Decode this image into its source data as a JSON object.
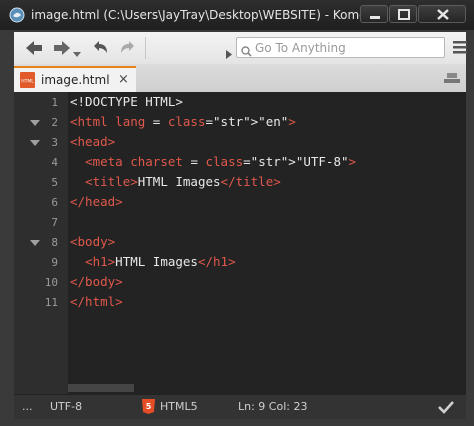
{
  "window": {
    "title": "image.html (C:\\Users\\JayTray\\Desktop\\WEBSITE) - Komodo E..."
  },
  "toolbar": {
    "search_placeholder": "Go To Anything"
  },
  "tabs": [
    {
      "label": "image.html",
      "icon": "html-file-icon",
      "close": "×"
    }
  ],
  "editor": {
    "lines": [
      {
        "num": "1",
        "fold": false,
        "text": "<!DOCTYPE HTML>"
      },
      {
        "num": "2",
        "fold": true,
        "text": "<html lang = \"en\">"
      },
      {
        "num": "3",
        "fold": true,
        "text": "<head>"
      },
      {
        "num": "4",
        "fold": false,
        "text": "  <meta charset = \"UTF-8\">"
      },
      {
        "num": "5",
        "fold": false,
        "text": "  <title>HTML Images</title>"
      },
      {
        "num": "6",
        "fold": false,
        "text": "</head>"
      },
      {
        "num": "7",
        "fold": false,
        "text": ""
      },
      {
        "num": "8",
        "fold": true,
        "text": "<body>"
      },
      {
        "num": "9",
        "fold": false,
        "text": "  <h1>HTML Images</h1>"
      },
      {
        "num": "10",
        "fold": false,
        "text": "</body>"
      },
      {
        "num": "11",
        "fold": false,
        "text": "</html>"
      }
    ]
  },
  "status": {
    "ellipsis": "...",
    "encoding": "UTF-8",
    "language": "HTML5",
    "position": "Ln: 9 Col: 23"
  },
  "colors": {
    "tag": "#e0584b",
    "string": "#e0c05a",
    "accent": "#e8831c"
  }
}
